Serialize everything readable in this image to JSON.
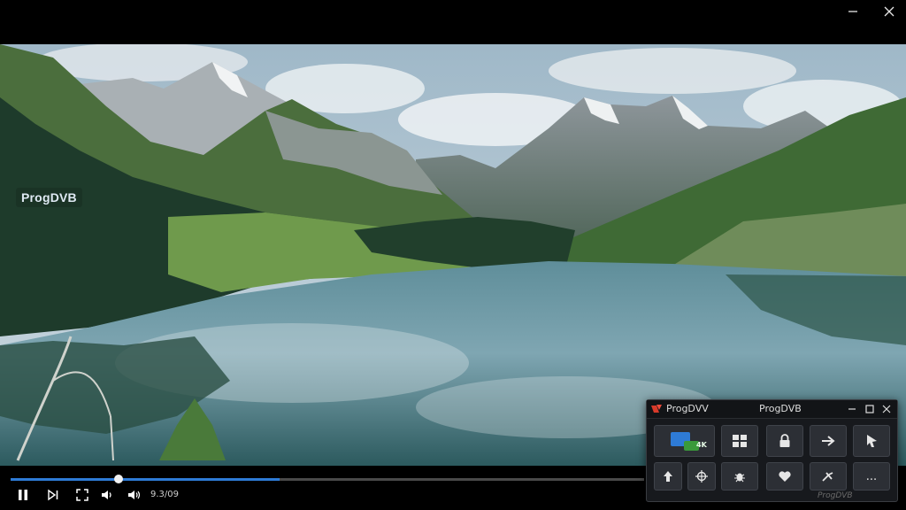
{
  "window": {
    "minimize_icon": "minimize-icon",
    "close_icon": "close-icon"
  },
  "video": {
    "channel_logo": "ProgDVB"
  },
  "player": {
    "progress_fraction": 0.425,
    "time": "9.3/09",
    "accent_color": "#2e7bd6",
    "buttons": [
      "pause-icon",
      "next-frame-icon",
      "fullscreen-icon",
      "audio-icon",
      "volume-icon"
    ]
  },
  "mini_panel": {
    "app_name": "ProgDVV",
    "title": "ProgDVB",
    "tiles_row1": [
      "4k-screen-icon",
      "grid-icon",
      "lock-icon",
      "arrow-right-icon",
      "cursor-icon"
    ],
    "tiles_row2": [
      "upload-icon",
      "crosshair-icon",
      "bug-icon",
      "heart-icon",
      "tools-icon",
      "more-icon"
    ],
    "more_label": "...",
    "badge": "4K"
  },
  "watermark": "ProgDVB"
}
